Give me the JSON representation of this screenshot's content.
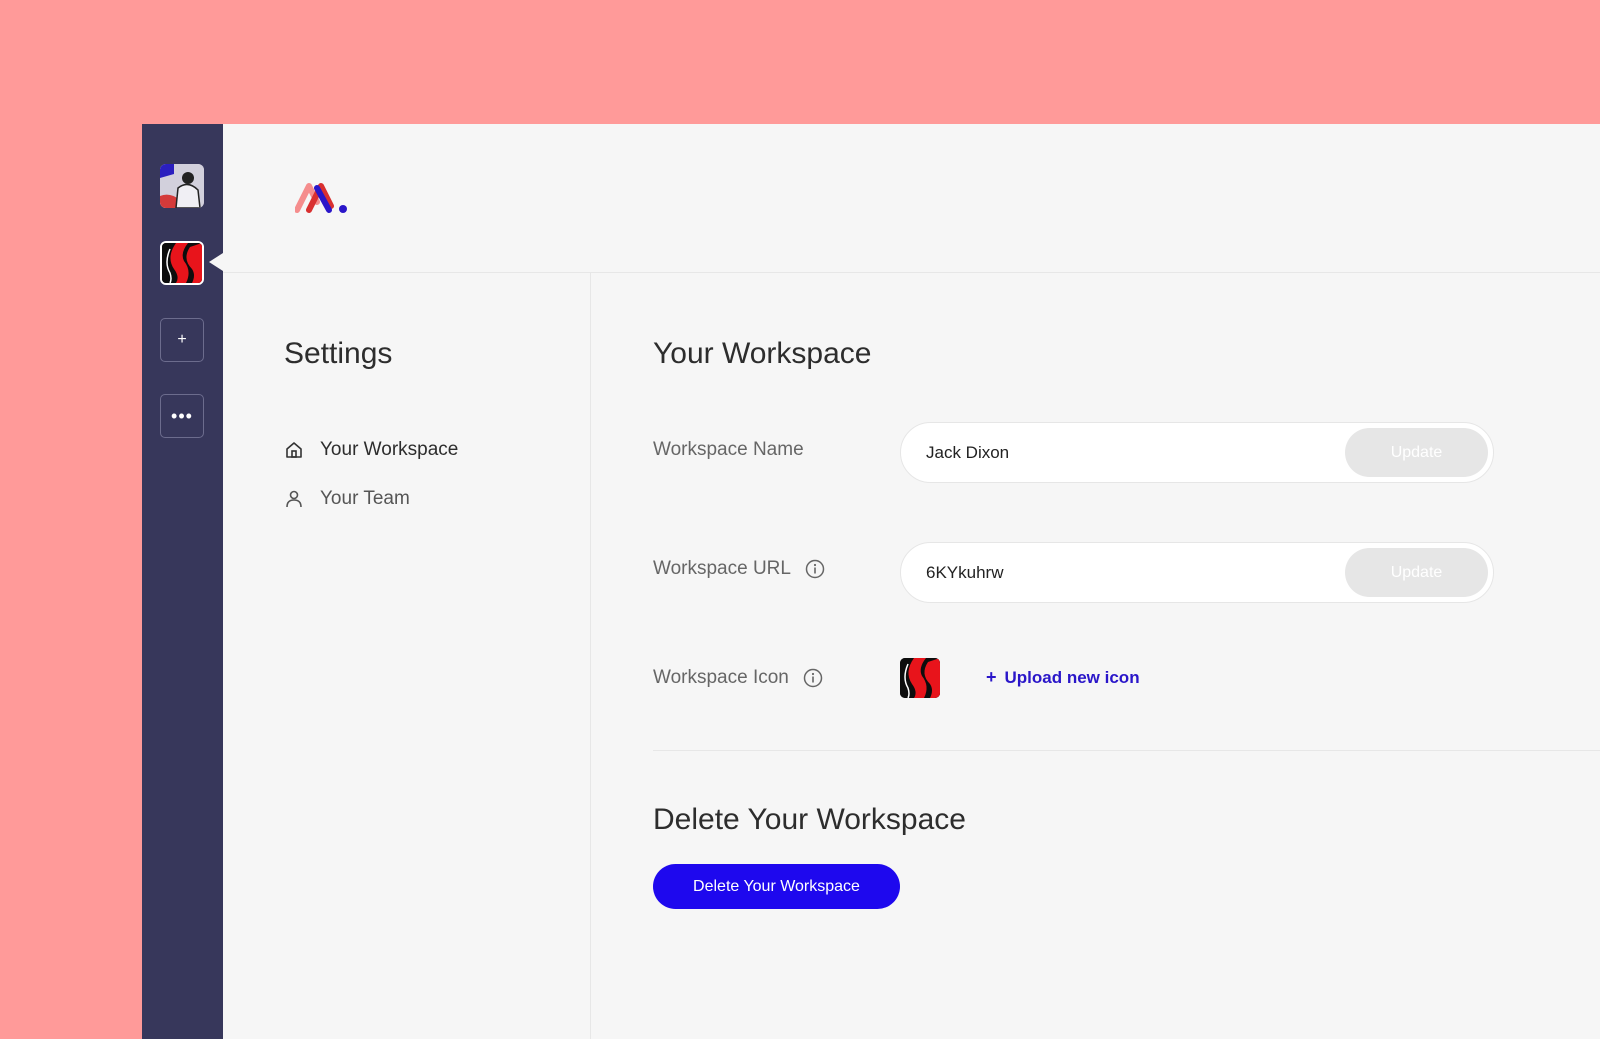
{
  "rail": {
    "add_label": "+",
    "more_label": "•••"
  },
  "sidebar": {
    "title": "Settings",
    "items": [
      {
        "label": "Your Workspace",
        "icon": "home-icon",
        "active": true
      },
      {
        "label": "Your Team",
        "icon": "user-icon",
        "active": false
      }
    ]
  },
  "main": {
    "workspace_title": "Your Workspace",
    "fields": {
      "name": {
        "label": "Workspace Name",
        "value": "Jack Dixon",
        "button": "Update"
      },
      "url": {
        "label": "Workspace URL",
        "value": "6KYkuhrw",
        "button": "Update"
      },
      "icon": {
        "label": "Workspace Icon",
        "upload_label": "Upload new icon"
      }
    },
    "delete_title": "Delete Your Workspace",
    "delete_button": "Delete Your Workspace"
  },
  "colors": {
    "background": "#ff9a99",
    "rail": "#37375b",
    "surface": "#f6f6f6",
    "accent": "#1e08ee",
    "link": "#2a16c9"
  }
}
